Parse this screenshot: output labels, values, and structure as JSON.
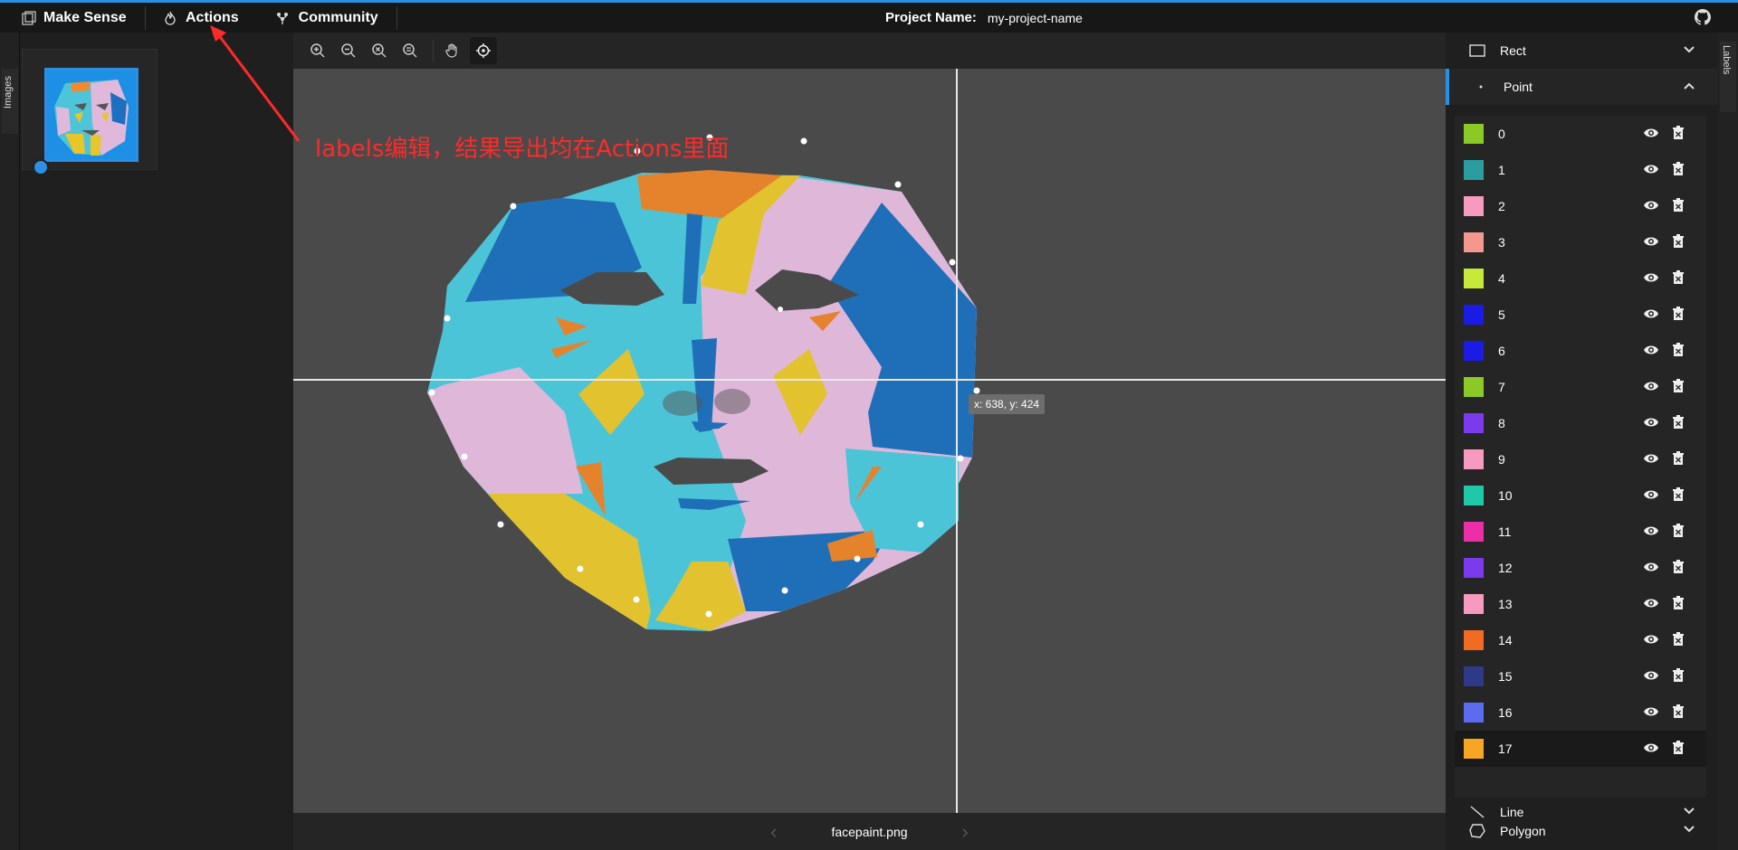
{
  "app": {
    "brand": "Make Sense",
    "nav": [
      {
        "label": "Actions",
        "icon": "fire-icon"
      },
      {
        "label": "Community",
        "icon": "community-icon"
      }
    ],
    "project_label": "Project Name:",
    "project_value": "my-project-name"
  },
  "left_tab": {
    "label": "Images"
  },
  "right_tab": {
    "label": "Labels"
  },
  "canvas": {
    "coord_readout": "x: 638, y: 424",
    "annotation": "labels编辑，结果导出均在Actions里面"
  },
  "bottom": {
    "filename": "facepaint.png"
  },
  "tools": {
    "rect": "Rect",
    "point": "Point",
    "line": "Line",
    "polygon": "Polygon"
  },
  "labels": [
    {
      "name": "0",
      "color": "#8ac926"
    },
    {
      "name": "1",
      "color": "#2a9d9f"
    },
    {
      "name": "2",
      "color": "#f79ac0"
    },
    {
      "name": "3",
      "color": "#f4978e"
    },
    {
      "name": "4",
      "color": "#c6e93a"
    },
    {
      "name": "5",
      "color": "#1a1ce6"
    },
    {
      "name": "6",
      "color": "#1a1ce6"
    },
    {
      "name": "7",
      "color": "#8ac926"
    },
    {
      "name": "8",
      "color": "#7c3aed"
    },
    {
      "name": "9",
      "color": "#f79ac0"
    },
    {
      "name": "10",
      "color": "#1ec8a8"
    },
    {
      "name": "11",
      "color": "#ec2fa6"
    },
    {
      "name": "12",
      "color": "#7c3aed"
    },
    {
      "name": "13",
      "color": "#f79ac0"
    },
    {
      "name": "14",
      "color": "#f26b22"
    },
    {
      "name": "15",
      "color": "#2e3a87"
    },
    {
      "name": "16",
      "color": "#5b6cf0"
    },
    {
      "name": "17",
      "color": "#f6a623"
    }
  ]
}
